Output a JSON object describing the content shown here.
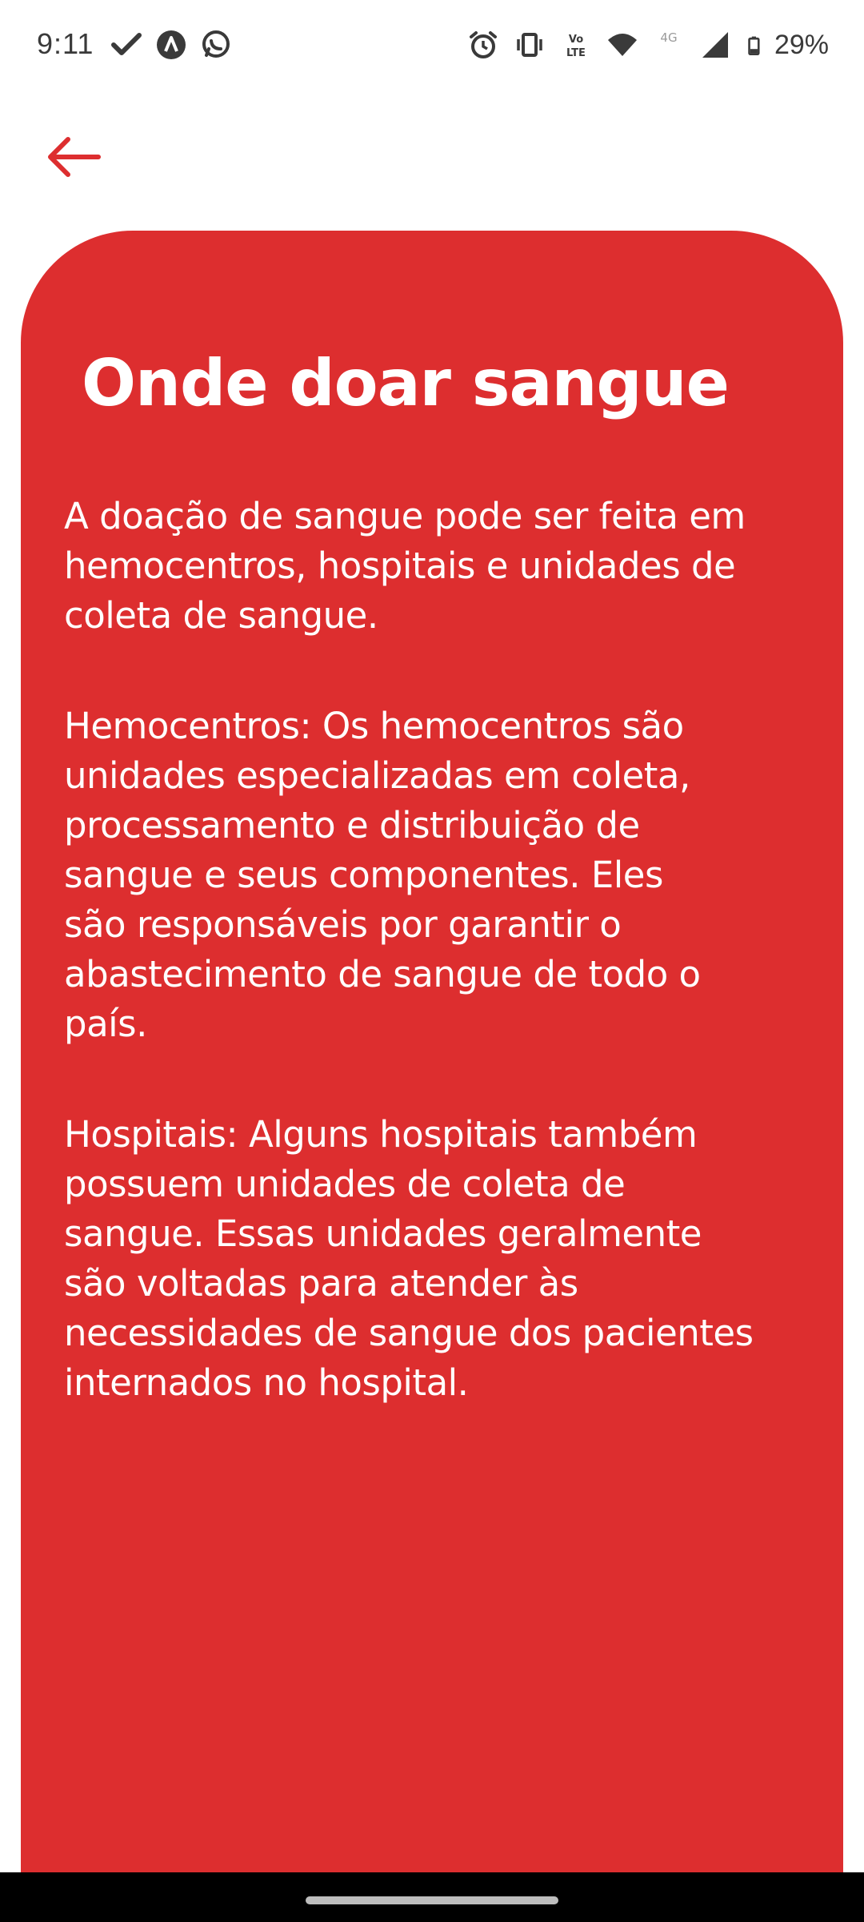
{
  "status_bar": {
    "time": "9:11",
    "left_icons": [
      "check-icon",
      "app-icon",
      "whatsapp-icon"
    ],
    "right_icons": [
      "alarm-icon",
      "vibrate-icon",
      "volte-icon",
      "wifi-icon",
      "4g-icon",
      "signal-icon",
      "battery-icon"
    ],
    "battery": "29%"
  },
  "header": {
    "back_icon": "arrow-left-icon",
    "accent_color": "#dd2e2f"
  },
  "card": {
    "background_color": "#dd2e2f",
    "title": "Onde doar sangue",
    "paragraphs": [
      "A doação de sangue pode ser feita em\nhemocentros, hospitais e unidades de\ncoleta de sangue.",
      "Hemocentros: Os hemocentros são\nunidades especializadas em coleta,\nprocessamento e distribuição de\nsangue e seus componentes. Eles\nsão responsáveis por garantir o\nabastecimento de sangue de todo o\npaís.",
      "Hospitais: Alguns hospitais também\npossuem unidades de coleta de\nsangue. Essas unidades geralmente\nsão voltadas para atender às\nnecessidades de sangue dos pacientes\ninternados no hospital."
    ]
  }
}
